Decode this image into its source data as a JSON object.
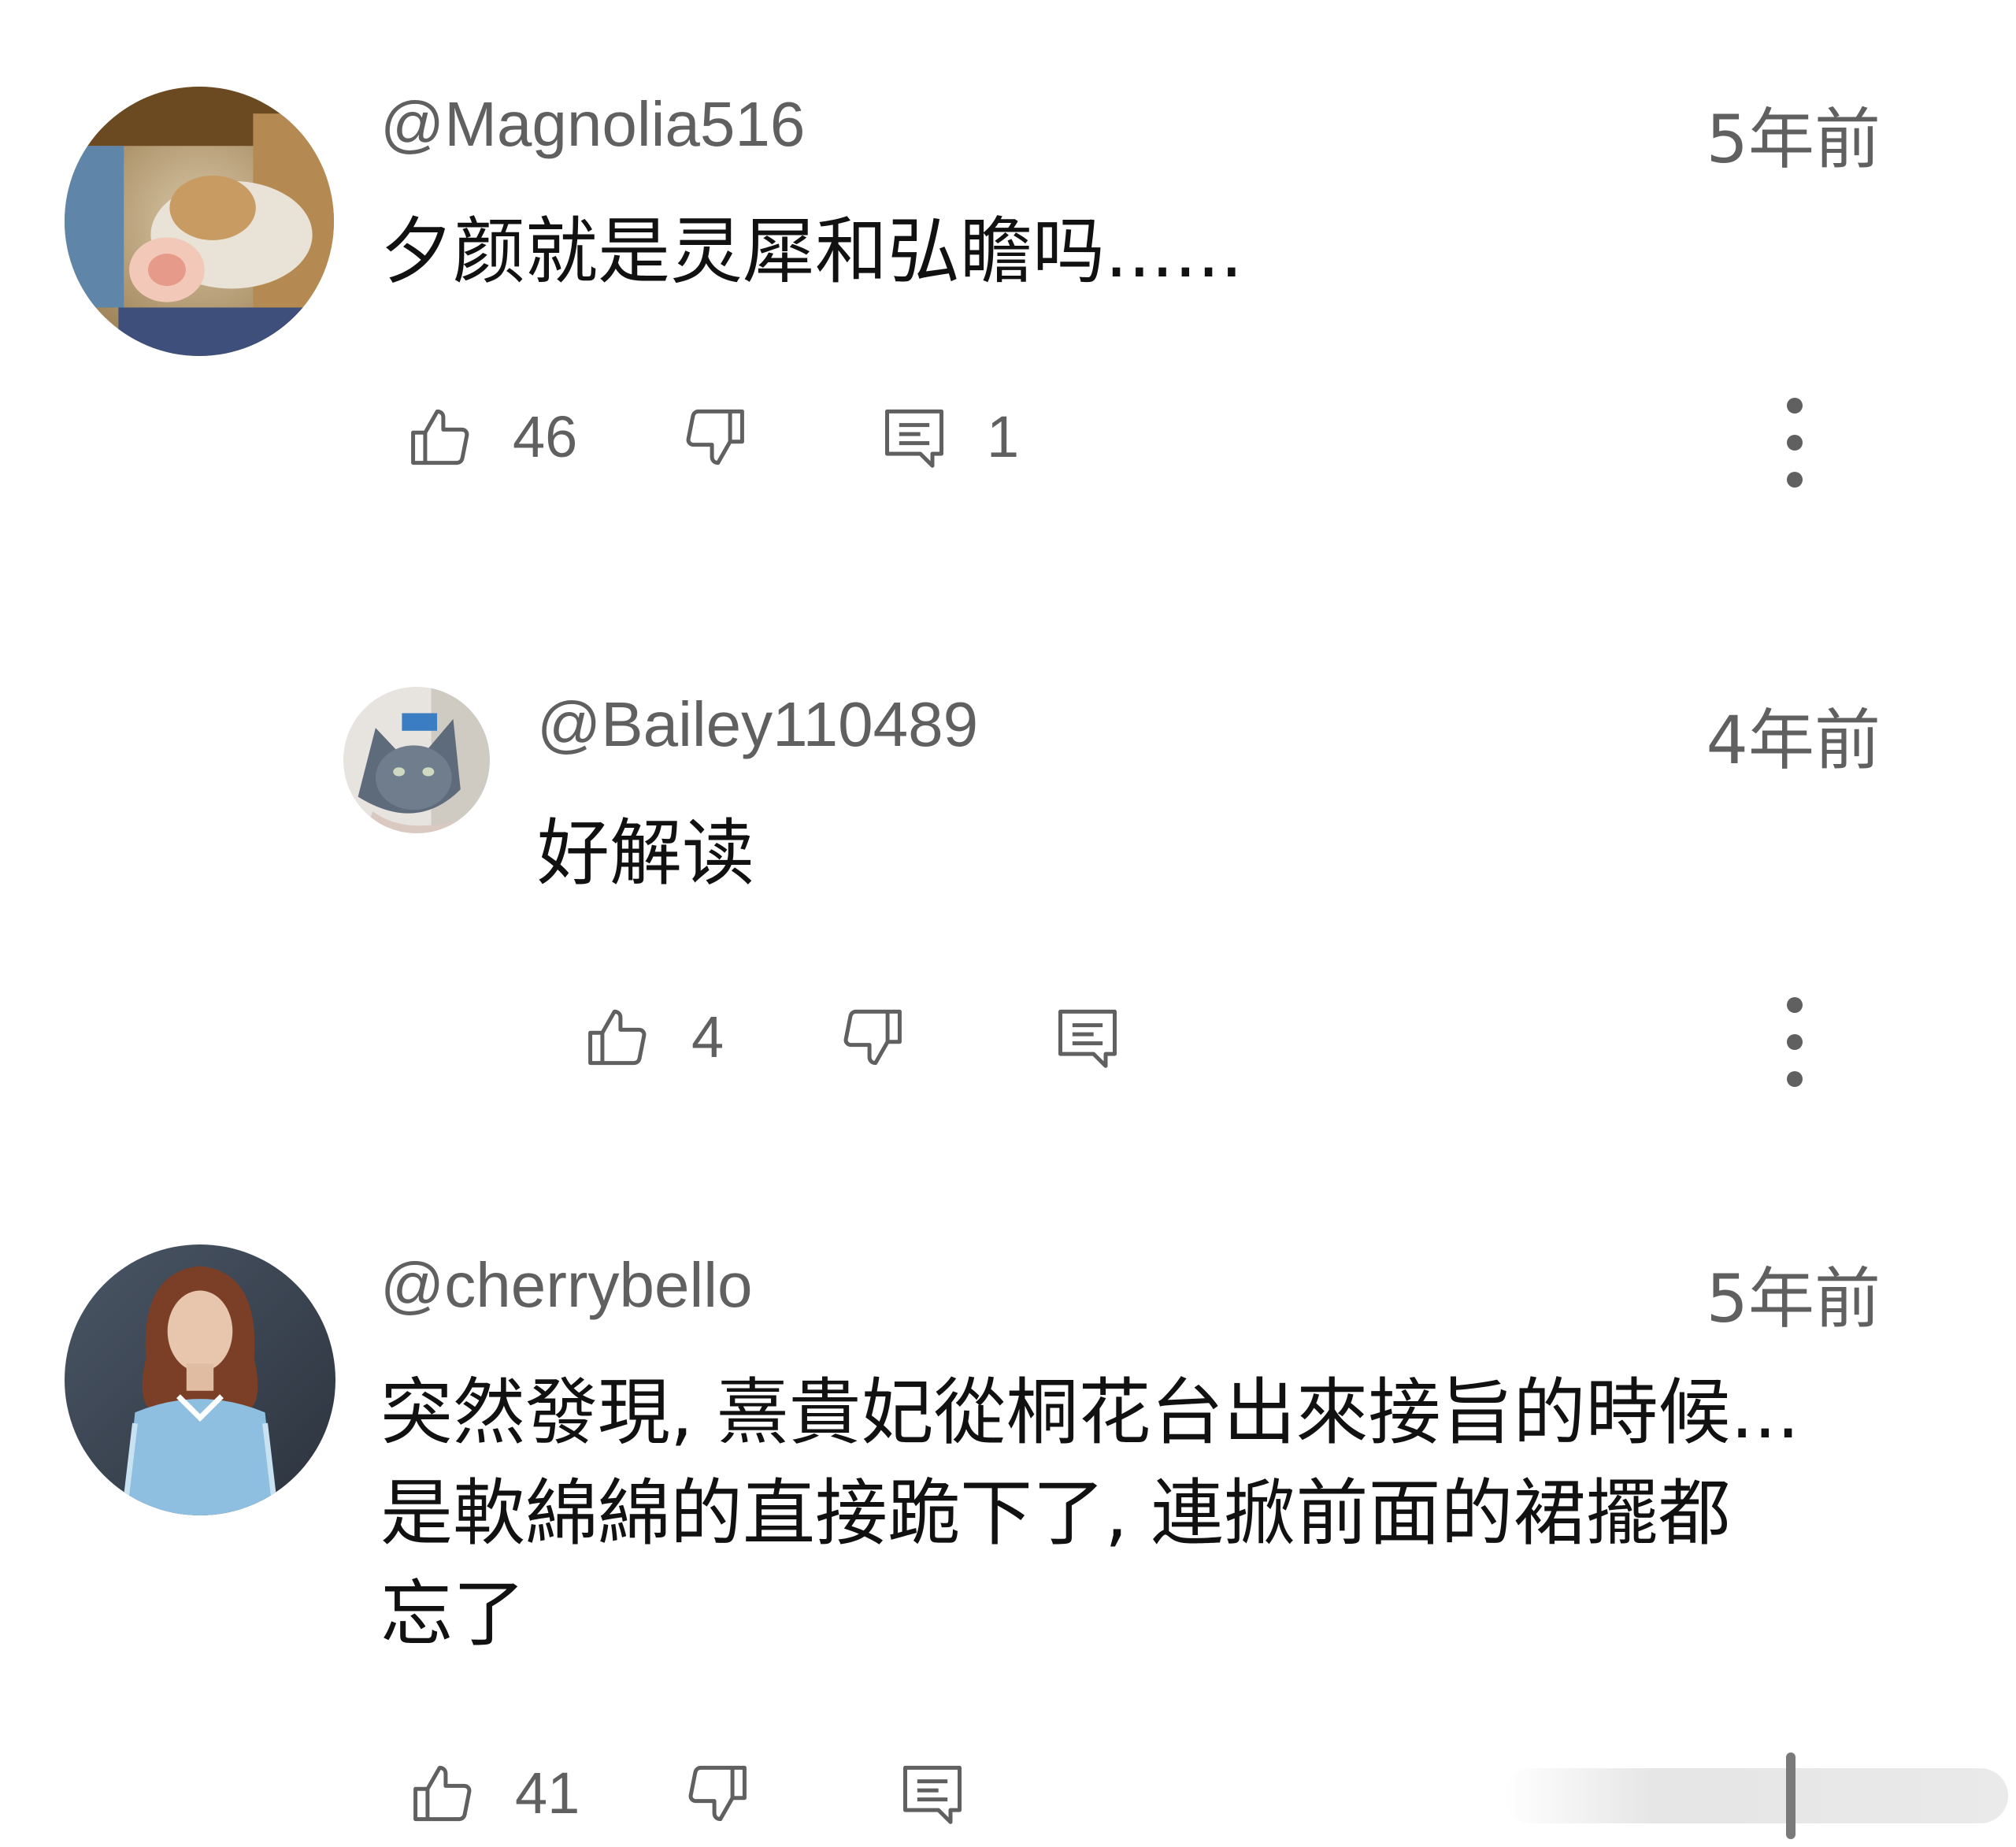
{
  "comments": [
    {
      "handle": "@Magnolia516",
      "time": "5年前",
      "text_lines": [
        "夕颜就是灵犀和弘瞻吗......"
      ],
      "likes": "46",
      "replies": "1",
      "avatar_icon": "cat-photo-avatar"
    },
    {
      "handle": "@Bailey110489",
      "time": "4年前",
      "text_lines": [
        "好解读"
      ],
      "likes": "4",
      "replies": "",
      "avatar_icon": "cat-portrait-avatar"
    },
    {
      "handle": "@cherrybello",
      "time": "5年前",
      "text_lines": [
        "突然發現, 熹貴妃從桐花台出來接旨的時候...",
        "是軟綿綿的直接跪下了, 連掀前面的裙擺都",
        "忘了"
      ],
      "likes": "41",
      "replies": "",
      "avatar_icon": "woman-photo-avatar"
    }
  ],
  "icons": {
    "like": "thumbs-up-icon",
    "dislike": "thumbs-down-icon",
    "reply": "reply-comment-icon",
    "more": "more-vertical-icon"
  },
  "colors": {
    "secondary_text": "#606060",
    "primary_text": "#111111",
    "background": "#ffffff"
  }
}
